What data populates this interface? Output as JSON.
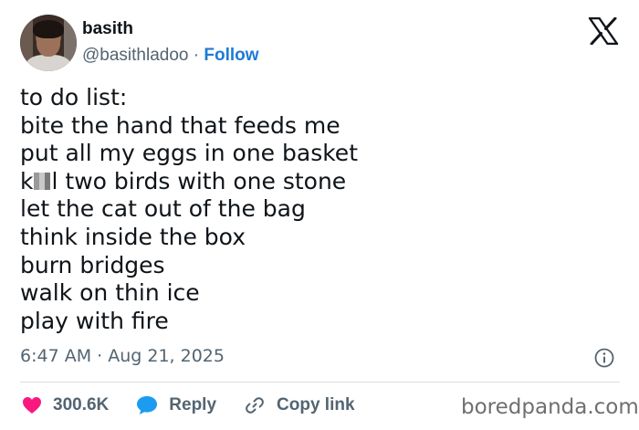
{
  "post": {
    "author": {
      "display_name": "basith",
      "handle": "@basithladoo",
      "separator": "·",
      "follow_label": "Follow"
    },
    "platform_icon": "x-logo-icon",
    "lines": [
      "to do list:",
      "bite the hand that feeds me",
      "put all my eggs in one basket",
      "two birds with one stone",
      "let the cat out of the bag",
      "think inside the box",
      "burn bridges",
      "walk on thin ice",
      "play with fire"
    ],
    "censored_word": {
      "start": "k",
      "end": "l"
    },
    "timestamp": "6:47 AM · Aug 21, 2025",
    "info_icon": "info-icon"
  },
  "actions": {
    "like": {
      "icon": "heart-icon",
      "count": "300.6K"
    },
    "reply": {
      "icon": "speech-bubble-icon",
      "label": "Reply"
    },
    "copy_link": {
      "icon": "link-icon",
      "label": "Copy link"
    }
  },
  "watermark": "boredpanda.com",
  "colors": {
    "follow": "#1d7bd6",
    "muted_text": "#536471",
    "heart": "#f91880",
    "reply_bubble": "#1d9bf0"
  }
}
